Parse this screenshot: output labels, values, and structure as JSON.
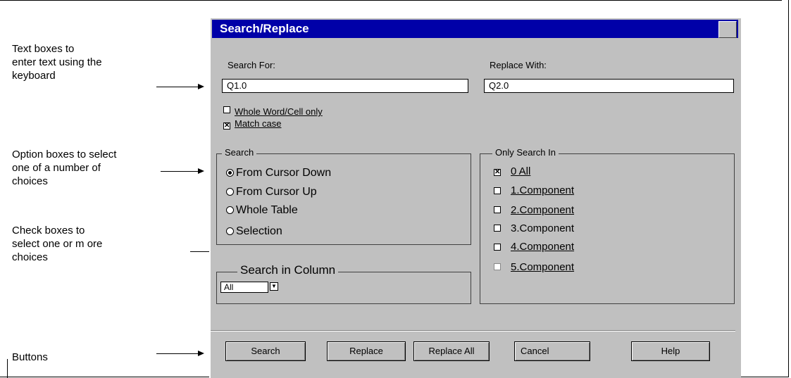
{
  "annotations": {
    "text_boxes": [
      "Text boxes to",
      "enter text using the",
      "keyboard"
    ],
    "option_boxes": [
      "Option boxes to select",
      "one of a number of",
      "choices"
    ],
    "check_boxes": [
      "Check boxes to",
      "select one or m ore",
      "choices"
    ],
    "buttons": "Buttons"
  },
  "dialog": {
    "title": "Search/Replace",
    "search_for_label": "Search For:",
    "search_for_value": "Q1.0",
    "replace_with_label": "Replace With:",
    "replace_with_value": "Q2.0",
    "whole_word": {
      "label": "Whole Word/Cell only",
      "checked": false
    },
    "match_case": {
      "label": "Match case",
      "checked": true
    },
    "search_group": {
      "legend": "Search",
      "options": [
        {
          "label": "From Cursor Down",
          "selected": true
        },
        {
          "label": "From Cursor Up",
          "selected": false
        },
        {
          "label": "Whole Table",
          "selected": false
        },
        {
          "label": "Selection",
          "selected": false
        }
      ]
    },
    "column_group": {
      "legend": "Search in Column",
      "selected": "All"
    },
    "only_search_in": {
      "legend": "Only Search In",
      "items": [
        {
          "label": "0 All",
          "checked": true
        },
        {
          "label": "1.Component",
          "checked": false
        },
        {
          "label": "2.Component",
          "checked": false
        },
        {
          "label": "3.Component",
          "checked": false
        },
        {
          "label": "4.Component",
          "checked": false
        },
        {
          "label": "5.Component",
          "checked": false
        }
      ]
    },
    "buttons": {
      "search": "Search",
      "replace": "Replace",
      "replace_all": "Replace All",
      "cancel": "Cancel",
      "help": "Help"
    }
  }
}
